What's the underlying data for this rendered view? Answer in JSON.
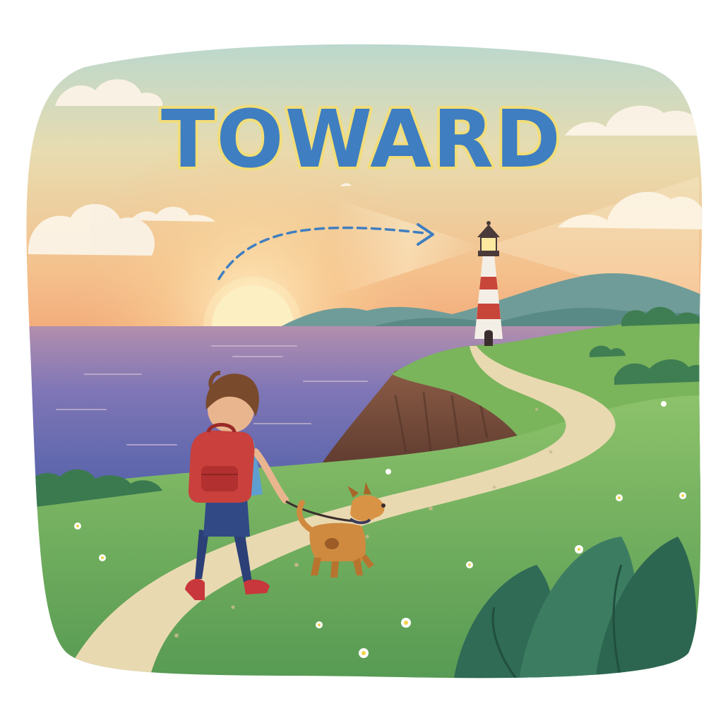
{
  "title": "TOWARD",
  "colors": {
    "title_fill": "#3f7ec0",
    "title_outline": "#f1dd7a",
    "sky_top": "#a9d6d8",
    "sky_bottom": "#f2b67f",
    "sea": "#6e6fb4",
    "grass": "#6aa84f",
    "path": "#e9d9b1",
    "lighthouse_red": "#c8453a",
    "backpack": "#c9403c",
    "dog": "#cf8a3f",
    "arrow": "#3f7ec0"
  }
}
